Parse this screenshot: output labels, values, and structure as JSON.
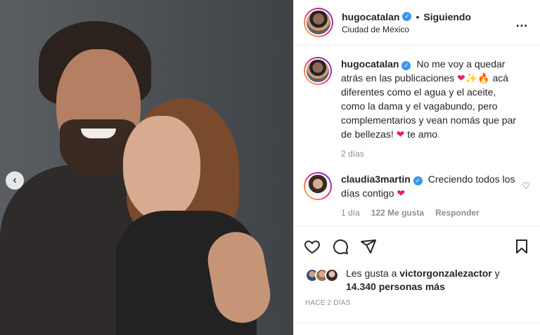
{
  "post": {
    "author": {
      "username": "hugocatalan",
      "verified_icon": "verified-badge-icon",
      "follow_dot": "•",
      "follow_status": "Siguiendo",
      "location": "Ciudad de México"
    },
    "more_icon": "…",
    "carousel_prev_icon": "‹",
    "caption": {
      "username": "hugocatalan",
      "text_part1": "No me voy a quedar atrás en las publicaciones",
      "emoji_heart": "❤",
      "emoji_spark": "✨",
      "emoji_fire": "🔥",
      "text_part2": "acá diferentes como el agua y el aceite, como la dama y el vagabundo, pero complementarios y vean nomás que par de bellezas!",
      "emoji_heart2": "❤",
      "text_part3": "te amo",
      "time": "2 días"
    },
    "comments": [
      {
        "username": "claudia3martin",
        "text": "Creciendo todos los días contigo",
        "emoji": "❤",
        "time": "1 día",
        "likes": "122 Me gusta",
        "reply_label": "Responder",
        "like_icon": "♡"
      }
    ],
    "likes": {
      "prefix": "Les gusta a",
      "user": "victorgonzalezactor",
      "joiner": "y",
      "count": "14.340 personas más"
    },
    "posted_time": "HACE 2 DÍAS"
  }
}
